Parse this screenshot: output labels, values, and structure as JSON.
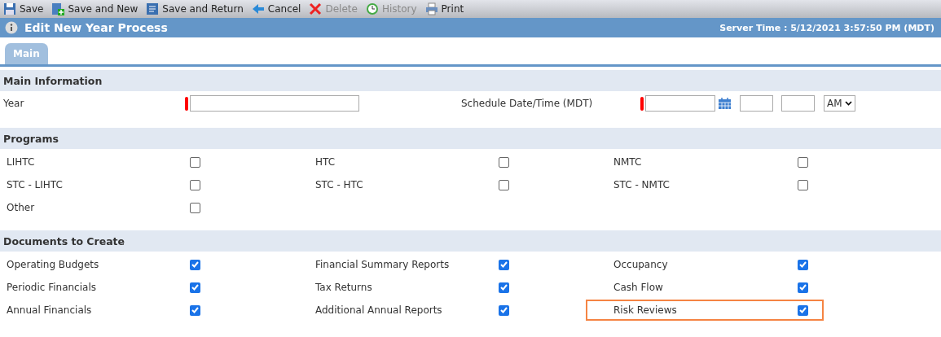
{
  "toolbar": [
    {
      "label": "Save",
      "disabled": false
    },
    {
      "label": "Save and New",
      "disabled": false
    },
    {
      "label": "Save and Return",
      "disabled": false
    },
    {
      "label": "Cancel",
      "disabled": false
    },
    {
      "label": "Delete",
      "disabled": true
    },
    {
      "label": "History",
      "disabled": true
    },
    {
      "label": "Print",
      "disabled": false
    }
  ],
  "title_bar": {
    "title": "Edit New Year Process",
    "server_time": "Server Time : 5/12/2021 3:57:50 PM (MDT)"
  },
  "tabs": [
    {
      "label": "Main",
      "selected": true
    }
  ],
  "main_information": {
    "title": "Main Information",
    "year_label": "Year",
    "schedule_label": "Schedule Date/Time (MDT)",
    "meridiem": "AM"
  },
  "programs": {
    "title": "Programs",
    "items": [
      {
        "label": "LIHTC",
        "checked": false,
        "highlighted": false
      },
      {
        "label": "HTC",
        "checked": false,
        "highlighted": false
      },
      {
        "label": "NMTC",
        "checked": false,
        "highlighted": false
      },
      {
        "label": "STC - LIHTC",
        "checked": false,
        "highlighted": false
      },
      {
        "label": "STC - HTC",
        "checked": false,
        "highlighted": false
      },
      {
        "label": "STC - NMTC",
        "checked": false,
        "highlighted": false
      },
      {
        "label": "Other",
        "checked": false,
        "highlighted": false
      }
    ]
  },
  "documents": {
    "title": "Documents to Create",
    "items": [
      {
        "label": "Operating Budgets",
        "checked": true,
        "highlighted": false
      },
      {
        "label": "Financial Summary Reports",
        "checked": true,
        "highlighted": false
      },
      {
        "label": "Occupancy",
        "checked": true,
        "highlighted": false
      },
      {
        "label": "Periodic Financials",
        "checked": true,
        "highlighted": false
      },
      {
        "label": "Tax Returns",
        "checked": true,
        "highlighted": false
      },
      {
        "label": "Cash Flow",
        "checked": true,
        "highlighted": false
      },
      {
        "label": "Annual Financials",
        "checked": true,
        "highlighted": false
      },
      {
        "label": "Additional Annual Reports",
        "checked": true,
        "highlighted": false
      },
      {
        "label": "Risk Reviews",
        "checked": true,
        "highlighted": true
      }
    ]
  }
}
